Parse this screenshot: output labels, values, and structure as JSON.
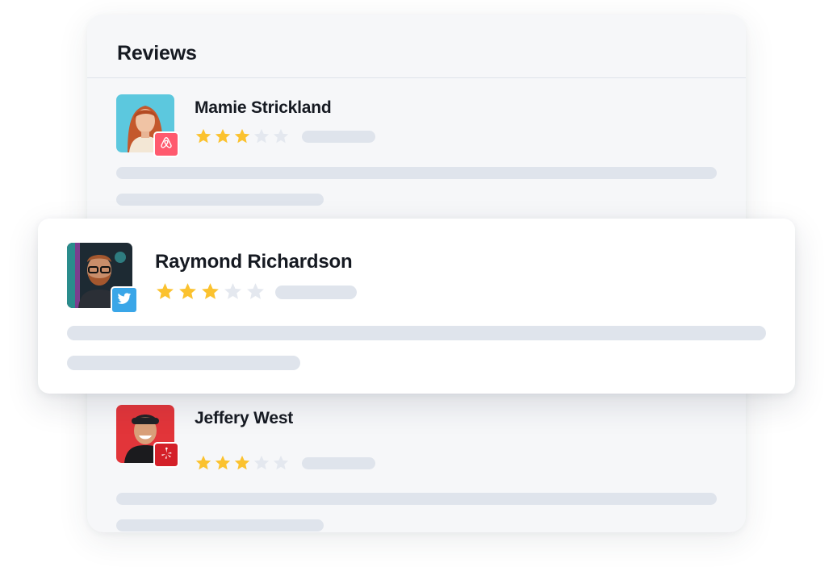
{
  "panel": {
    "title": "Reviews"
  },
  "reviews": [
    {
      "name": "Mamie Strickland",
      "rating": 3,
      "max_rating": 5,
      "source": "airbnb",
      "source_icon": "airbnb-icon",
      "source_color": "#ff5a6e"
    },
    {
      "name": "Raymond Richardson",
      "rating": 3,
      "max_rating": 5,
      "source": "twitter",
      "source_icon": "twitter-icon",
      "source_color": "#3aa6e8"
    },
    {
      "name": "Jeffery West",
      "rating": 3,
      "max_rating": 5,
      "source": "yelp",
      "source_icon": "yelp-icon",
      "source_color": "#d42029"
    }
  ],
  "colors": {
    "star_filled": "#fbc22f",
    "star_empty": "#e4e8ef",
    "placeholder": "#dfe4ec",
    "card_background": "#f6f7f9"
  }
}
